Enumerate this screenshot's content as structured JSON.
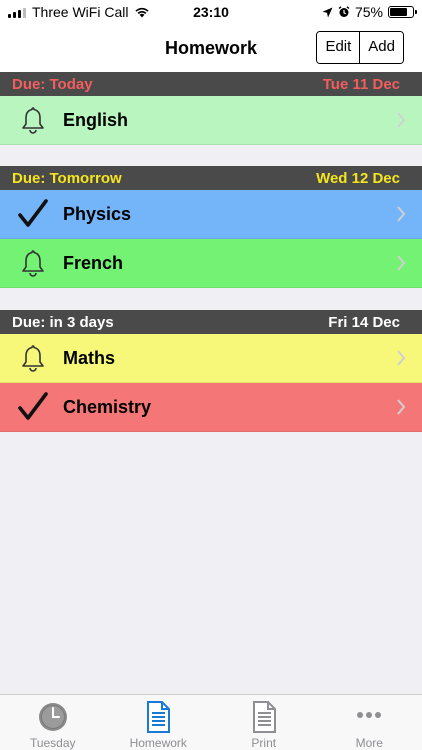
{
  "status_bar": {
    "carrier": "Three WiFi Call",
    "time": "23:10",
    "battery": "75%",
    "battery_level": 0.75
  },
  "nav": {
    "title": "Homework",
    "edit_label": "Edit",
    "add_label": "Add"
  },
  "sections": [
    {
      "due": "Due: Today",
      "date": "Tue 11 Dec",
      "header_color": "#f25e5e",
      "items": [
        {
          "subject": "English",
          "icon": "bell-icon",
          "color": "#b9f5bf"
        }
      ]
    },
    {
      "due": "Due: Tomorrow",
      "date": "Wed 12 Dec",
      "header_color": "#f5e51f",
      "items": [
        {
          "subject": "Physics",
          "icon": "checkmark-icon",
          "color": "#74b5fa"
        },
        {
          "subject": "French",
          "icon": "bell-icon",
          "color": "#73f274"
        }
      ]
    },
    {
      "due": "Due: in 3 days",
      "date": "Fri 14 Dec",
      "header_color": "#ffffff",
      "items": [
        {
          "subject": "Maths",
          "icon": "bell-icon",
          "color": "#f7f779"
        },
        {
          "subject": "Chemistry",
          "icon": "checkmark-icon",
          "color": "#f47676"
        }
      ]
    }
  ],
  "tabs": [
    {
      "label": "Tuesday",
      "icon": "clock-icon",
      "active": false
    },
    {
      "label": "Homework",
      "icon": "document-icon",
      "active": true
    },
    {
      "label": "Print",
      "icon": "print-document-icon",
      "active": false
    },
    {
      "label": "More",
      "icon": "more-icon",
      "active": false
    }
  ]
}
